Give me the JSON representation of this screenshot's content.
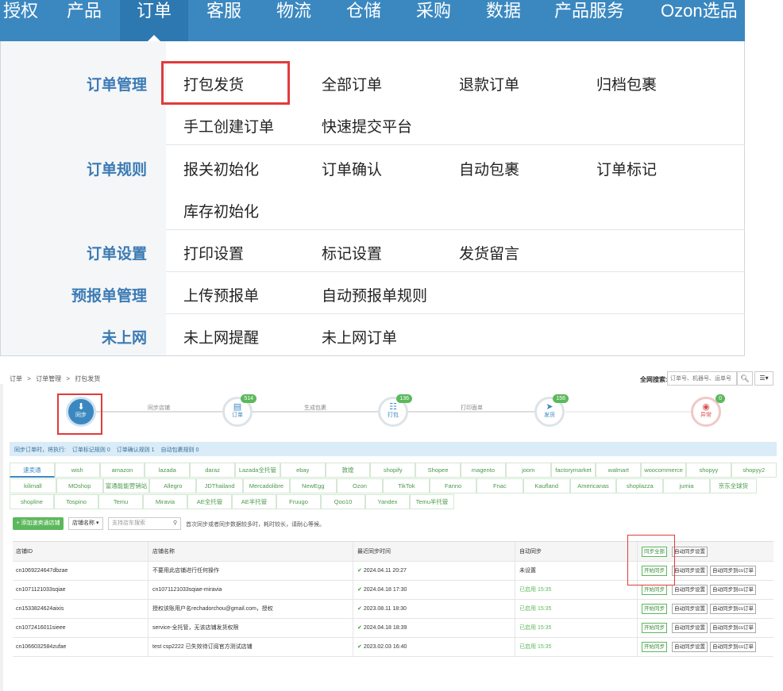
{
  "topnav": {
    "items": [
      "授权",
      "产品",
      "订单",
      "客服",
      "物流",
      "仓储",
      "采购",
      "数据",
      "产品服务",
      "Ozon选品"
    ],
    "active_index": 2
  },
  "dropdown": {
    "sections": [
      {
        "category": "订单管理",
        "links": [
          "打包发货",
          "全部订单",
          "退款订单",
          "归档包裹",
          "手工创建订单",
          "快速提交平台"
        ]
      },
      {
        "category": "订单规则",
        "links": [
          "报关初始化",
          "订单确认",
          "自动包裹",
          "订单标记",
          "库存初始化"
        ]
      },
      {
        "category": "订单设置",
        "links": [
          "打印设置",
          "标记设置",
          "发货留言"
        ]
      },
      {
        "category": "预报单管理",
        "links": [
          "上传预报单",
          "自动预报单规则"
        ]
      },
      {
        "category": "未上网",
        "links": [
          "未上网提醒",
          "未上网订单"
        ]
      }
    ],
    "highlighted": "打包发货"
  },
  "breadcrumb": [
    "订单",
    ">",
    "订单管理",
    ">",
    "打包发货"
  ],
  "global_search": {
    "label": "全网搜索:",
    "placeholder": "订单号、机器号、运单号",
    "button_icon": "search-icon",
    "menu_icon": "list-menu-icon"
  },
  "steps": [
    {
      "label": "同步",
      "icon": "download-icon",
      "badge": ""
    },
    {
      "label": "订单",
      "icon": "list-icon",
      "badge": "514"
    },
    {
      "label": "打包",
      "icon": "barcode-icon",
      "badge": "136"
    },
    {
      "label": "发货",
      "icon": "send-icon",
      "badge": "156"
    },
    {
      "label": "异常",
      "icon": "eye-off-icon",
      "badge": "0"
    }
  ],
  "step_connectors": [
    "同步店铺",
    "生成包裹",
    "打印面单"
  ],
  "infobar": [
    "同步订单时，将执行:",
    "订单标记规则 0",
    "订单确认规则 1",
    "自动包裹规则 0"
  ],
  "platform_tabs": [
    [
      "速卖通",
      "wish",
      "amazon",
      "lazada",
      "daraz",
      "Lazada全托管",
      "ebay",
      "敦煌",
      "shopify",
      "Shopee",
      "magento",
      "joom",
      "factorymarket",
      "walmart",
      "woocommerce",
      "shopyy",
      "shopyy2"
    ],
    [
      "kilimall",
      "MOshop",
      "富通能能营销站",
      "Allegro",
      "JDThailand",
      "Mercadolibre",
      "NewEgg",
      "Ozon",
      "TikTok",
      "Fanno",
      "Fnac",
      "Kaufland",
      "Americanas",
      "shoplazza",
      "jumia",
      "京东全球货"
    ],
    [
      "shopline",
      "Tospino",
      "Temu",
      "Miravia",
      "AE全托管",
      "AE半托管",
      "Fruugo",
      "Qoo10",
      "Yandex",
      "Temu半托管"
    ]
  ],
  "toolbar": {
    "add_label": "+ 添加速卖通店铺",
    "select_label": "店铺名称 ▾",
    "search_placeholder": "支持店车搜索",
    "hint": "首次同步或者同步数据较多时，耗时较长，请耐心等候。"
  },
  "table": {
    "headers": [
      "店铺ID",
      "店铺名称",
      "最近同步时间",
      "自动同步",
      ""
    ],
    "head_buttons": [
      "同步全部",
      "自动同步设置"
    ],
    "rows": [
      {
        "id": "cn1069224647dbzae",
        "name": "不要用此店铺进行任何操作",
        "time": "2024.04.11 20:27",
        "auto": "未设置",
        "auto_green": false
      },
      {
        "id": "cn1071121033sqiae",
        "name": "cn1071121033sqiae-miravia",
        "time": "2024.04.18 17:30",
        "auto": "已启用 15:35",
        "auto_green": true
      },
      {
        "id": "cn1533824624aixis",
        "name": "授权该账用户名rechadorchou@gmail.com，授权",
        "time": "2023.08.11 18:30",
        "auto": "已启用 15:35",
        "auto_green": true
      },
      {
        "id": "cn1072416011sieee",
        "name": "service-全托管，无该店铺发货权限",
        "time": "2024.04.18 18:39",
        "auto": "已启用 15:35",
        "auto_green": true
      },
      {
        "id": "cn1066032584zufae",
        "name": "test csp2222 已失效待订阅官方测试店铺",
        "time": "2023.02.03 16:40",
        "auto": "已启用 15:35",
        "auto_green": true
      }
    ],
    "row_buttons": [
      "开始同步",
      "自动同步设置",
      "自动同步到cs订单"
    ]
  }
}
